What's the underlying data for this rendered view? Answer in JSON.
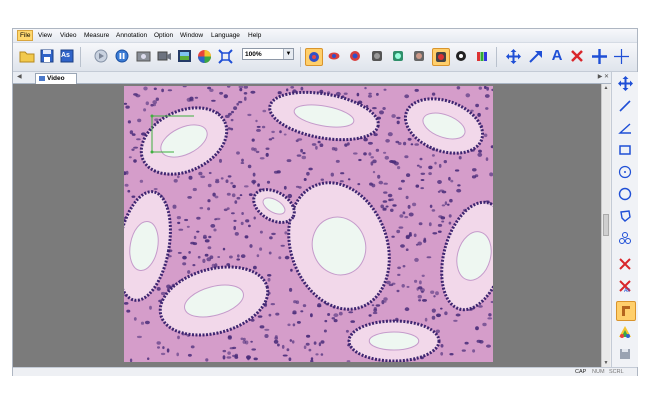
{
  "menubar": {
    "items": [
      "File",
      "View",
      "Video",
      "Measure",
      "Annotation",
      "Option",
      "Window",
      "Language",
      "Help"
    ],
    "active": "File"
  },
  "toolbar": {
    "zoom_value": "100%",
    "save_as_label": "As",
    "text_tool_label": "A"
  },
  "tabs": [
    {
      "label": "Video",
      "active": true
    }
  ],
  "statusbar": {
    "cap": "CAP",
    "num": "NUM",
    "scrl": "SCRL"
  },
  "colors": {
    "accent_highlight": "#ffcf6b",
    "tool_blue": "#1f4fd6",
    "delete_red": "#d9262b",
    "tissue_pink": "#e7b3d6",
    "nuclei_purple": "#4a2d7a"
  },
  "icons": {
    "toolbar": [
      "open-folder-icon",
      "save-icon",
      "save-as-icon",
      "play-icon",
      "pause-icon",
      "capture-icon",
      "record-icon",
      "film-icon",
      "color-wheel-icon",
      "fit-screen-icon",
      "mode-icon-1",
      "mode-icon-2",
      "mode-icon-3",
      "mode-icon-4",
      "mode-icon-5",
      "mode-icon-6",
      "mode-icon-7",
      "mode-icon-8",
      "mode-icon-9",
      "move-icon",
      "arrow-icon",
      "text-icon",
      "delete-icon",
      "crosshair-icon",
      "thin-crosshair-icon"
    ],
    "rightbar": [
      "move-icon",
      "line-icon",
      "angle-icon",
      "rectangle-icon",
      "circle-center-icon",
      "circle-icon",
      "polygon-icon",
      "multi-circle-icon",
      "delete-icon",
      "delete-all-icon",
      "layer-icon",
      "color-icon",
      "save-icon"
    ]
  }
}
